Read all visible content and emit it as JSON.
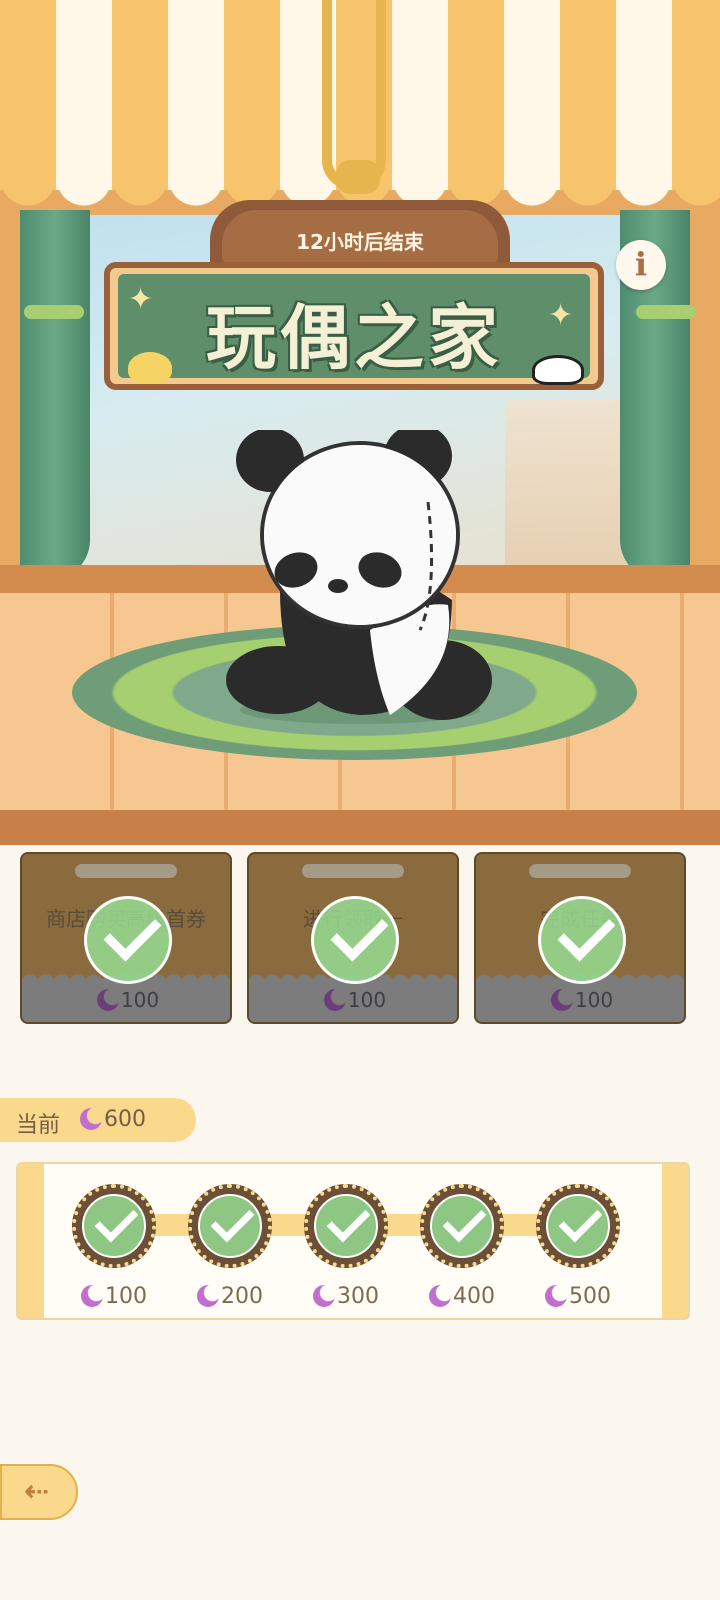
{
  "event": {
    "countdown": "12小时后结束",
    "title": "玩偶之家",
    "info_label": "i"
  },
  "tasks": [
    {
      "label": "商店购买高级首券",
      "reward": "100",
      "completed": true
    },
    {
      "label": "进行领取一",
      "reward": "100",
      "completed": true
    },
    {
      "label": "完成任务",
      "reward": "100",
      "completed": true
    }
  ],
  "current": {
    "label": "当前",
    "value": "600"
  },
  "milestones": [
    {
      "value": "100",
      "claimed": true
    },
    {
      "value": "200",
      "claimed": true
    },
    {
      "value": "300",
      "claimed": true
    },
    {
      "value": "400",
      "claimed": true
    },
    {
      "value": "500",
      "claimed": true
    }
  ],
  "nav": {
    "back_label": "⇠"
  },
  "icons": {
    "currency": "moon-icon",
    "check": "check-icon",
    "info": "info-icon",
    "back": "back-arrow-icon"
  },
  "colors": {
    "accent": "#fbd98c",
    "sign_green": "#5e8f6a",
    "check_green": "#96e296",
    "currency_purple": "#c06fcf"
  }
}
